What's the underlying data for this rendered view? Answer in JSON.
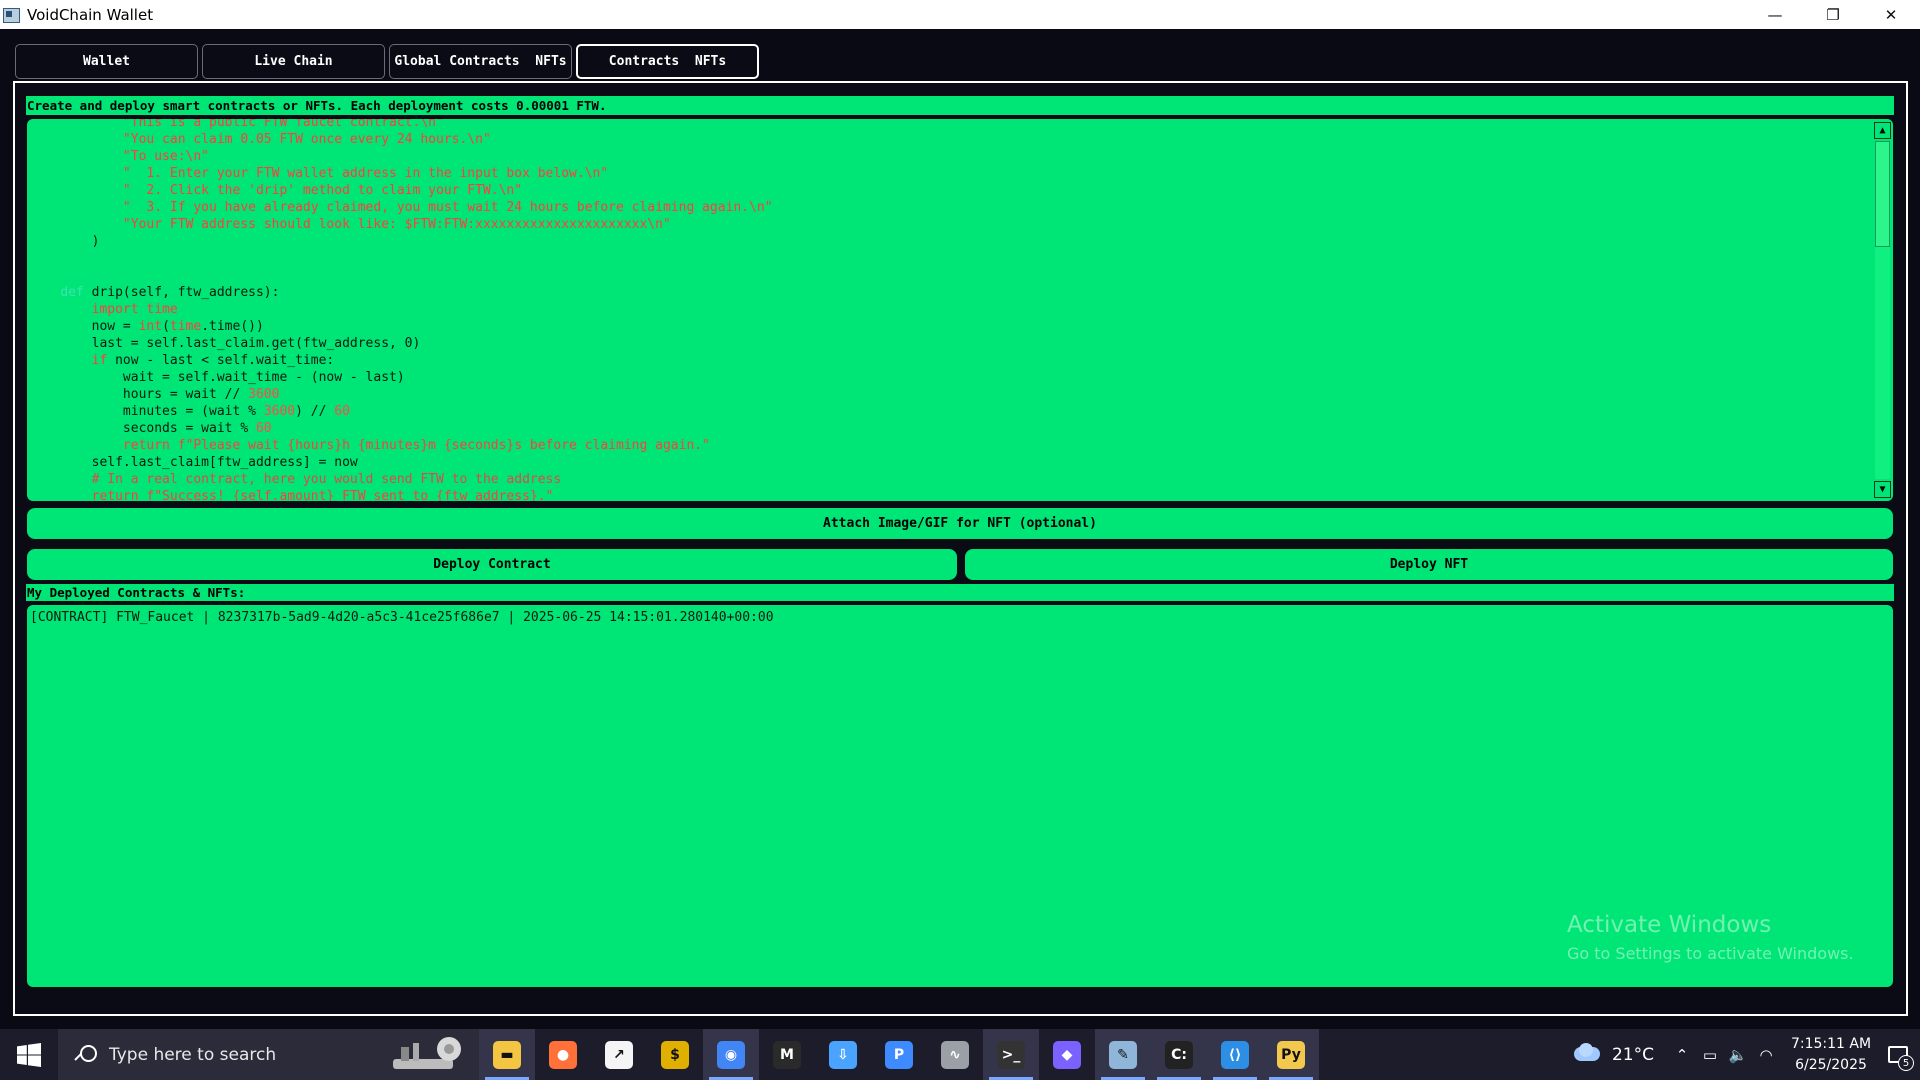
{
  "window": {
    "title": "VoidChain Wallet",
    "minimize_glyph": "—",
    "maximize_glyph": "❐",
    "close_glyph": "✕"
  },
  "tabs": [
    {
      "label": "Wallet",
      "active": false
    },
    {
      "label": "Live Chain",
      "active": false
    },
    {
      "label": "Global Contracts  NFTs",
      "active": false
    },
    {
      "label": "Contracts  NFTs",
      "active": true
    }
  ],
  "contracts_tab": {
    "header": "Create and deploy smart contracts or NFTs. Each deployment costs 0.00001 FTW.",
    "code_lines": [
      "            \"This is a public FTW faucet contract.\\n\"",
      "            \"You can claim 0.05 FTW once every 24 hours.\\n\"",
      "            \"To use:\\n\"",
      "            \"  1. Enter your FTW wallet address in the input box below.\\n\"",
      "            \"  2. Click the 'drip' method to claim your FTW.\\n\"",
      "            \"  3. If you have already claimed, you must wait 24 hours before claiming again.\\n\"",
      "            \"Your FTW address should look like: $FTW:FTW:xxxxxxxxxxxxxxxxxxxxxx\\n\"",
      "        )",
      "",
      "",
      "    def drip(self, ftw_address):",
      "        import time",
      "        now = int(time.time())",
      "        last = self.last_claim.get(ftw_address, 0)",
      "        if now - last < self.wait_time:",
      "            wait = self.wait_time - (now - last)",
      "            hours = wait // 3600",
      "            minutes = (wait % 3600) // 60",
      "            seconds = wait % 60",
      "            return f\"Please wait {hours}h {minutes}m {seconds}s before claiming again.\"",
      "        self.last_claim[ftw_address] = now",
      "        # In a real contract, here you would send FTW to the address",
      "        return f\"Success! {self.amount} FTW sent to {ftw_address}.\""
    ],
    "attach_button": "Attach Image/GIF for NFT (optional)",
    "deploy_contract_button": "Deploy Contract",
    "deploy_nft_button": "Deploy NFT",
    "deployed_label": "My Deployed Contracts & NFTs:",
    "deployed_items": [
      "[CONTRACT] FTW_Faucet | 8237317b-5ad9-4d20-a5c3-41ce25f686e7 | 2025-06-25 14:15:01.280140+00:00"
    ],
    "scroll_position": 0.0
  },
  "watermark": {
    "title": "Activate Windows",
    "subtitle": "Go to Settings to activate Windows."
  },
  "taskbar": {
    "search_placeholder": "Type here to search",
    "apps": [
      {
        "name": "file-explorer",
        "color": "#f4c542",
        "running": true
      },
      {
        "name": "firefox",
        "color": "#ff7139",
        "running": false
      },
      {
        "name": "stocks-app",
        "color": "#f5f5f5",
        "running": false
      },
      {
        "name": "coin-app",
        "color": "#e0b000",
        "running": false
      },
      {
        "name": "chrome",
        "color": "#4285f4",
        "running": true
      },
      {
        "name": "mm-app",
        "color": "#2a2a2a",
        "running": false
      },
      {
        "name": "download-manager",
        "color": "#4aa3ff",
        "running": false
      },
      {
        "name": "p-app",
        "color": "#3d8bff",
        "running": false
      },
      {
        "name": "curve-app",
        "color": "#9aa0a6",
        "running": false
      },
      {
        "name": "terminal",
        "color": "#333333",
        "running": true
      },
      {
        "name": "gem-app",
        "color": "#7b61ff",
        "running": false
      },
      {
        "name": "notepad",
        "color": "#8fb6d9",
        "running": true
      },
      {
        "name": "cmd",
        "color": "#222222",
        "running": true
      },
      {
        "name": "vscode",
        "color": "#2d8ee6",
        "running": true
      },
      {
        "name": "python",
        "color": "#f2c94c",
        "running": true
      }
    ],
    "temperature": "21°C",
    "time": "7:15:11 AM",
    "date": "6/25/2025",
    "notification_count": "5"
  },
  "colors": {
    "accent_green": "#00e676",
    "background": "#0b0b16",
    "code_string": "#ff3d3d",
    "code_keyword": "#39e3b0"
  }
}
